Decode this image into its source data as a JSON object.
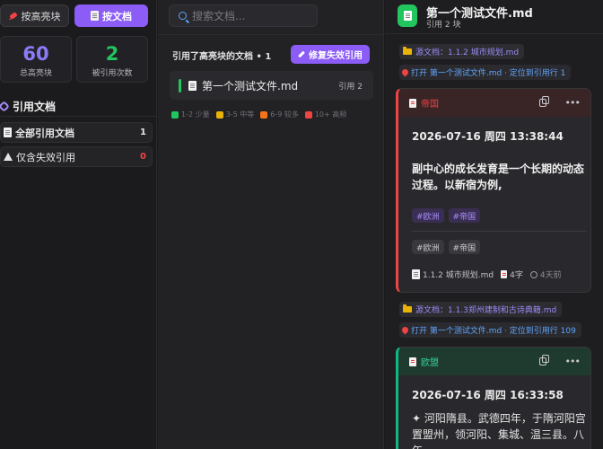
{
  "left": {
    "mode_buttons": [
      {
        "label": "按高亮块",
        "active": false
      },
      {
        "label": "按文档",
        "active": true
      }
    ],
    "stats": [
      {
        "value": "60",
        "label": "总高亮块"
      },
      {
        "value": "2",
        "label": "被引用次数"
      }
    ],
    "section_title": "引用文档",
    "filters": [
      {
        "label": "全部引用文档",
        "count": "1"
      },
      {
        "label": "仅含失效引用",
        "count": "0"
      }
    ]
  },
  "middle": {
    "search_placeholder": "搜索文档...",
    "list_title": "引用了高亮块的文档 • 1",
    "repair_label": "修复失效引用",
    "docs": [
      {
        "name": "第一个测试文件.md",
        "cite": "引用 2"
      }
    ],
    "legend": [
      {
        "label": "1-2 少量",
        "color": "#22c55e"
      },
      {
        "label": "3-5 中等",
        "color": "#eab308"
      },
      {
        "label": "6-9 较多",
        "color": "#f97316"
      },
      {
        "label": "10+ 高频",
        "color": "#ef4444"
      }
    ]
  },
  "right": {
    "title": "第一个测试文件.md",
    "subtitle": "引用 2 块",
    "groups": [
      {
        "source": "源文档：1.1.2 城市规划.md",
        "open": "打开 第一个测试文件.md · 定位到引用行 1",
        "card": {
          "name": "帝国",
          "time": "2026-07-16 周四 13:38:44",
          "text": "副中心的成长发育是一个长期的动态过程。以新宿为例,",
          "tags_primary": [
            "#欧洲",
            "#帝国"
          ],
          "tags_secondary": [
            "#欧洲",
            "#帝国"
          ],
          "foot_doc": "1.1.2 城市规划.md",
          "foot_chars": "4字",
          "foot_age": "4天前"
        }
      },
      {
        "source": "源文档：1.1.3郑州建制和古诗典籍.md",
        "open": "打开 第一个测试文件.md · 定位到引用行 109",
        "card": {
          "name": "欧盟",
          "time": "2026-07-16 周四 16:33:58",
          "text": "✦ 河阳隋县。武德四年，于隋河阳宫置盟州，领河阳、集城、温三县。八年,"
        }
      }
    ]
  },
  "colors": {
    "accent": "#8b5cf6",
    "green": "#22c55e",
    "red": "#ef4444",
    "link": "#60a5fa"
  }
}
